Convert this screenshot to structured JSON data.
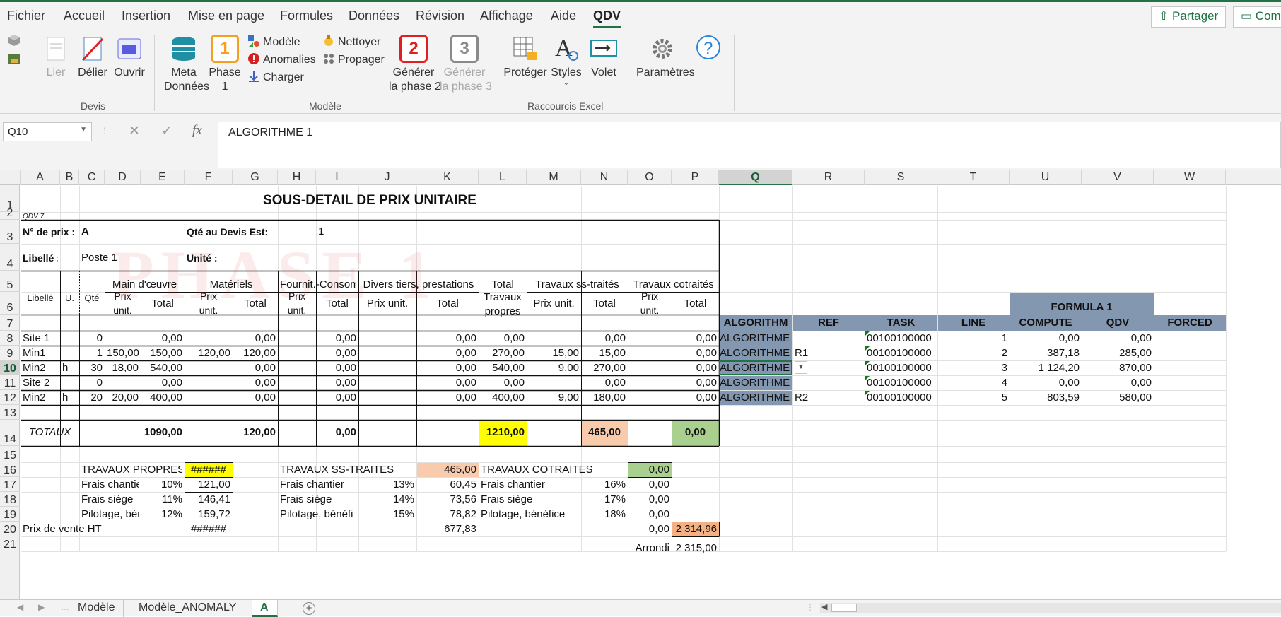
{
  "menu": {
    "tabs": [
      "Fichier",
      "Accueil",
      "Insertion",
      "Mise en page",
      "Formules",
      "Données",
      "Révision",
      "Affichage",
      "Aide",
      "QDV"
    ],
    "active": "QDV",
    "share_label": "Partager",
    "comments_label": "Com"
  },
  "ribbon": {
    "lier": "Lier",
    "delier": "Délier",
    "ouvrir": "Ouvrir",
    "devis_group": "Devis",
    "meta_line1": "Meta",
    "meta_line2": "Données",
    "phase_badge": "1",
    "phase_line1": "Phase",
    "phase_line2": "1",
    "modele": "Modèle",
    "anomalies": "Anomalies",
    "charger": "Charger",
    "nettoyer": "Nettoyer",
    "propager": "Propager",
    "gen2_badge": "2",
    "gen2_line1": "Générer",
    "gen2_line2": "la phase 2",
    "gen3_badge": "3",
    "gen3_line1": "Générer",
    "gen3_line2": "la phase 3",
    "modele_group": "Modèle",
    "proteger": "Protéger",
    "styles": "Styles",
    "volet": "Volet",
    "raccourcis_group": "Raccourcis Excel",
    "parametres": "Paramètres"
  },
  "formula_bar": {
    "name_box": "Q10",
    "content": "ALGORITHME 1",
    "fx": "fx"
  },
  "columns": [
    "A",
    "B",
    "C",
    "D",
    "E",
    "F",
    "G",
    "H",
    "I",
    "J",
    "K",
    "L",
    "M",
    "N",
    "O",
    "P",
    "Q",
    "R",
    "S",
    "T",
    "U",
    "V",
    "W"
  ],
  "selected_column": "Q",
  "rows": [
    "1",
    "2",
    "3",
    "4",
    "5",
    "6",
    "7",
    "8",
    "9",
    "10",
    "11",
    "12",
    "13",
    "14",
    "15",
    "16",
    "17",
    "18",
    "19",
    "20",
    "21"
  ],
  "selected_row": "10",
  "sheet": {
    "watermark": "PHASE 1",
    "title": "SOUS-DETAIL DE PRIX UNITAIRE",
    "qdv_tag": "QDV 7",
    "num_prix_label": "N° de prix :",
    "num_prix_value": "A",
    "qte_label": "Qté au Devis Est:",
    "qte_value": "1",
    "libelle_label": "Libellé :",
    "libelle_value": "Poste 1",
    "unite_label": "Unité :",
    "h_libelle": "Libellé",
    "h_u": "U.",
    "h_qte": "Qté",
    "h_mo": "Main d'œuvre",
    "h_mat": "Matériels",
    "h_fourn": "Fournit.-Consom",
    "h_divers": "Divers tiers, prestations",
    "h_total_line1": "Total",
    "h_total_line2": "Travaux",
    "h_total_line3": "propres",
    "h_sstraites": "Travaux ss-traités",
    "h_cotraites": "Travaux cotraités",
    "h_prix1": "Prix",
    "h_unit": "unit.",
    "h_total": "Total",
    "h_prixunit": "Prix unit.",
    "data_rows": [
      {
        "lib": "Site 1",
        "u": "",
        "qte": "0",
        "d": "",
        "e": "0,00",
        "f": "",
        "g": "0,00",
        "h": "",
        "i": "0,00",
        "j": "",
        "k": "0,00",
        "l": "0,00",
        "m": "",
        "n": "0,00",
        "o": "",
        "p": "0,00"
      },
      {
        "lib": "Min1",
        "u": "",
        "qte": "1",
        "d": "150,00",
        "e": "150,00",
        "f": "120,00",
        "g": "120,00",
        "h": "",
        "i": "0,00",
        "j": "",
        "k": "0,00",
        "l": "270,00",
        "m": "15,00",
        "n": "15,00",
        "o": "",
        "p": "0,00"
      },
      {
        "lib": "Min2",
        "u": "h",
        "qte": "30",
        "d": "18,00",
        "e": "540,00",
        "f": "",
        "g": "0,00",
        "h": "",
        "i": "0,00",
        "j": "",
        "k": "0,00",
        "l": "540,00",
        "m": "9,00",
        "n": "270,00",
        "o": "",
        "p": "0,00"
      },
      {
        "lib": "Site 2",
        "u": "",
        "qte": "0",
        "d": "",
        "e": "0,00",
        "f": "",
        "g": "0,00",
        "h": "",
        "i": "0,00",
        "j": "",
        "k": "0,00",
        "l": "0,00",
        "m": "",
        "n": "0,00",
        "o": "",
        "p": "0,00"
      },
      {
        "lib": "Min2",
        "u": "h",
        "qte": "20",
        "d": "20,00",
        "e": "400,00",
        "f": "",
        "g": "0,00",
        "h": "",
        "i": "0,00",
        "j": "",
        "k": "0,00",
        "l": "400,00",
        "m": "9,00",
        "n": "180,00",
        "o": "",
        "p": "0,00"
      }
    ],
    "totaux_label": "TOTAUX",
    "tot_e": "1090,00",
    "tot_g": "120,00",
    "tot_i": "0,00",
    "tot_l": "1210,00",
    "tot_n": "465,00",
    "tot_p": "0,00",
    "tp_label": "TRAVAUX PROPRES",
    "tp_value": "######",
    "tsst_label": "TRAVAUX SS-TRAITES",
    "tsst_value": "465,00",
    "tcot_label": "TRAVAUX COTRAITES",
    "tcot_value": "0,00",
    "fc_label": "Frais chantier",
    "fs_label": "Frais siège",
    "pb_label": "Pilotage, bénéfi",
    "pb_label_full": "Pilotage, bénéfice",
    "tp_fc_pct": "10%",
    "tp_fc_val": "121,00",
    "tp_fs_pct": "11%",
    "tp_fs_val": "146,41",
    "tp_pb_pct": "12%",
    "tp_pb_val": "159,72",
    "ss_fc_pct": "13%",
    "ss_fc_val": "60,45",
    "ss_fs_pct": "14%",
    "ss_fs_val": "73,56",
    "ss_pb_pct": "15%",
    "ss_pb_val": "78,82",
    "co_fc_pct": "16%",
    "co_fc_val": "0,00",
    "co_fs_pct": "17%",
    "co_fs_val": "0,00",
    "co_pb_pct": "18%",
    "co_pb_val": "0,00",
    "pv_label": "Prix de vente HT",
    "pv_tp": "######",
    "pv_ss": "677,83",
    "pv_co": "0,00",
    "pv_total": "2 314,96",
    "arrondi_label": "Arrondi",
    "arrondi_value": "2 315,00"
  },
  "right_table": {
    "group_header": "FORMULA 1",
    "headers": [
      "ALGORITHM",
      "REF",
      "TASK",
      "LINE",
      "COMPUTE",
      "QDV",
      "FORCED"
    ],
    "rows": [
      {
        "algorithm": "ALGORITHME",
        "ref": "",
        "task": "00100100000",
        "line": "1",
        "compute": "0,00",
        "qdv": "0,00",
        "forced": ""
      },
      {
        "algorithm": "ALGORITHME",
        "ref": "R1",
        "task": "00100100000",
        "line": "2",
        "compute": "387,18",
        "qdv": "285,00",
        "forced": ""
      },
      {
        "algorithm": "ALGORITHME",
        "ref": "",
        "task": "00100100000",
        "line": "3",
        "compute": "1 124,20",
        "qdv": "870,00",
        "forced": ""
      },
      {
        "algorithm": "ALGORITHME",
        "ref": "",
        "task": "00100100000",
        "line": "4",
        "compute": "0,00",
        "qdv": "0,00",
        "forced": ""
      },
      {
        "algorithm": "ALGORITHME",
        "ref": "R2",
        "task": "00100100000",
        "line": "5",
        "compute": "803,59",
        "qdv": "580,00",
        "forced": ""
      }
    ]
  },
  "tabs": {
    "sheets": [
      "Modèle",
      "Modèle_ANOMALY",
      "A"
    ],
    "active": "A"
  },
  "colors": {
    "accent": "#217346",
    "yellow": "#ffff00",
    "salmon": "#f8cbad",
    "green": "#a9d08e",
    "orange": "#f4b183",
    "header_blue": "#8497b0"
  }
}
